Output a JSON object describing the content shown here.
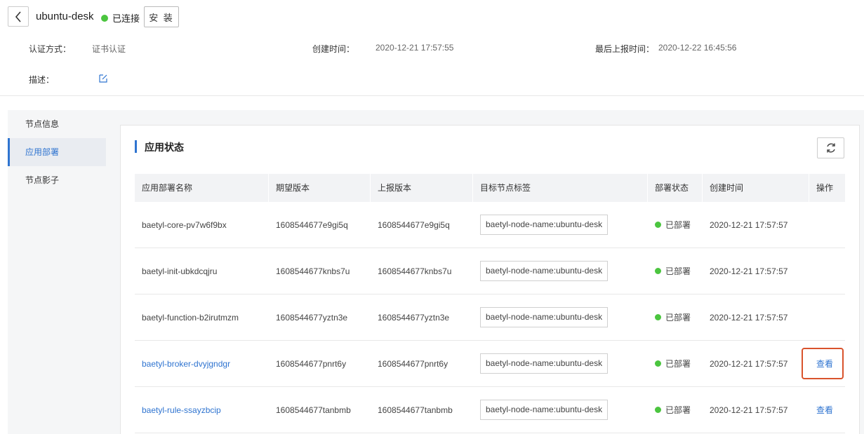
{
  "header": {
    "node_name": "ubuntu-desk",
    "status_text": "已连接",
    "install_label": "安 装",
    "auth_label": "认证方式：",
    "auth_value": "证书认证",
    "created_label": "创建时间：",
    "created_value": "2020-12-21 17:57:55",
    "reported_label": "最后上报时间：",
    "reported_value": "2020-12-22 16:45:56",
    "desc_label": "描述："
  },
  "sidebar": {
    "items": [
      {
        "label": "节点信息"
      },
      {
        "label": "应用部署"
      },
      {
        "label": "节点影子"
      }
    ]
  },
  "panel": {
    "title": "应用状态"
  },
  "table": {
    "headers": [
      "应用部署名称",
      "期望版本",
      "上报版本",
      "目标节点标签",
      "部署状态",
      "创建时间",
      "操作"
    ],
    "rows": [
      {
        "name": "baetyl-core-pv7w6f9bx",
        "expected": "1608544677e9gi5q",
        "reported": "1608544677e9gi5q",
        "tag": "baetyl-node-name:ubuntu-desk",
        "status": "已部署",
        "created": "2020-12-21 17:57:57",
        "action": ""
      },
      {
        "name": "baetyl-init-ubkdcqjru",
        "expected": "1608544677knbs7u",
        "reported": "1608544677knbs7u",
        "tag": "baetyl-node-name:ubuntu-desk",
        "status": "已部署",
        "created": "2020-12-21 17:57:57",
        "action": ""
      },
      {
        "name": "baetyl-function-b2irutmzm",
        "expected": "1608544677yztn3e",
        "reported": "1608544677yztn3e",
        "tag": "baetyl-node-name:ubuntu-desk",
        "status": "已部署",
        "created": "2020-12-21 17:57:57",
        "action": ""
      },
      {
        "name": "baetyl-broker-dvyjgndgr",
        "expected": "1608544677pnrt6y",
        "reported": "1608544677pnrt6y",
        "tag": "baetyl-node-name:ubuntu-desk",
        "status": "已部署",
        "created": "2020-12-21 17:57:57",
        "action": "查看"
      },
      {
        "name": "baetyl-rule-ssayzbcip",
        "expected": "1608544677tanbmb",
        "reported": "1608544677tanbmb",
        "tag": "baetyl-node-name:ubuntu-desk",
        "status": "已部署",
        "created": "2020-12-21 17:57:57",
        "action": "查看"
      }
    ]
  },
  "colors": {
    "accent": "#2f74d0",
    "status_green": "#4bc53f",
    "highlight": "#d9532c"
  }
}
